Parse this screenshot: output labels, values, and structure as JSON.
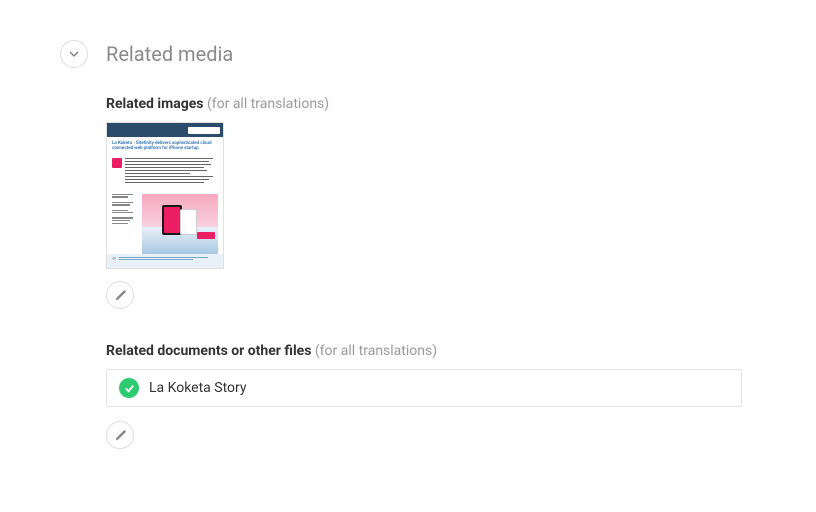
{
  "section": {
    "title": "Related media"
  },
  "related_images": {
    "label": "Related images",
    "scope": "(for all translations)",
    "items": [
      {
        "thumb_title": "La Koketa - Sitefinity delivers sophisticated cloud connected web platform for iPhone startup"
      }
    ]
  },
  "related_docs": {
    "label": "Related documents or other files",
    "scope": "(for all translations)",
    "items": [
      {
        "name": "La Koketa Story",
        "status": "ok"
      }
    ]
  }
}
